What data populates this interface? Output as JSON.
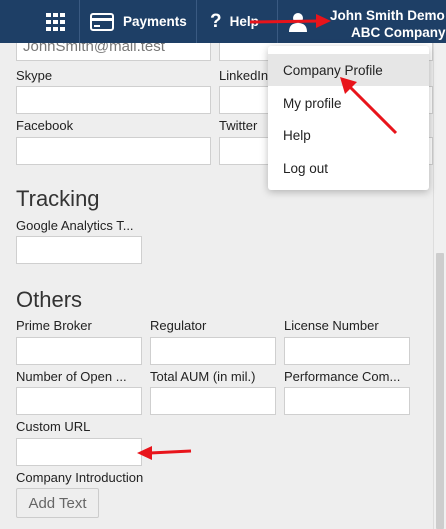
{
  "topbar": {
    "payments_label": "Payments",
    "help_label": "Help",
    "user_name": "John Smith Demo",
    "user_company": "ABC Company"
  },
  "icons": {
    "apps": "grid-icon",
    "payments": "credit-card-icon",
    "help": "question-icon",
    "user": "user-icon"
  },
  "contact": {
    "email_value": "JohnSmith@mail.test",
    "skype_label": "Skype",
    "linkedin_label": "LinkedIn",
    "facebook_label": "Facebook",
    "twitter_label": "Twitter"
  },
  "tracking": {
    "title": "Tracking",
    "ga_label": "Google Analytics T..."
  },
  "others": {
    "title": "Others",
    "prime_broker_label": "Prime Broker",
    "regulator_label": "Regulator",
    "license_label": "License Number",
    "open_label": "Number of Open ...",
    "aum_label": "Total AUM (in mil.)",
    "performance_label": "Performance Com...",
    "custom_url_label": "Custom URL",
    "intro_label": "Company Introduction",
    "add_text_label": "Add Text"
  },
  "dropdown": {
    "items": [
      {
        "label": "Company Profile"
      },
      {
        "label": "My profile"
      },
      {
        "label": "Help"
      },
      {
        "label": "Log out"
      }
    ]
  },
  "colors": {
    "topbar": "#1e3f66",
    "annotation_arrow": "#e8141b",
    "page_background": "#eeeeee"
  }
}
